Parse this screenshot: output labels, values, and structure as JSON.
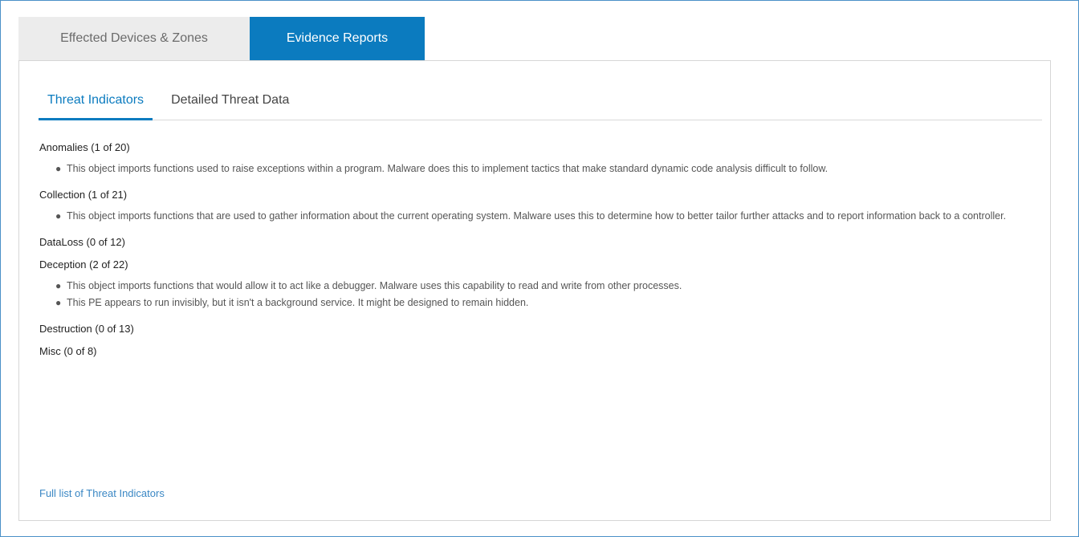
{
  "tabs": {
    "outer": [
      {
        "label": "Effected Devices & Zones",
        "active": false
      },
      {
        "label": "Evidence Reports",
        "active": true
      }
    ],
    "inner": [
      {
        "label": "Threat Indicators",
        "active": true
      },
      {
        "label": "Detailed Threat Data",
        "active": false
      }
    ]
  },
  "categories": [
    {
      "title": "Anomalies (1 of 20)",
      "items": [
        "This object imports functions used to raise exceptions within a program. Malware does this to implement tactics that make standard dynamic code analysis difficult to follow."
      ]
    },
    {
      "title": "Collection (1 of 21)",
      "items": [
        "This object imports functions that are used to gather information about the current operating system. Malware uses this to determine how to better tailor further attacks and to report information back to a controller."
      ]
    },
    {
      "title": "DataLoss (0 of 12)",
      "items": []
    },
    {
      "title": "Deception (2 of 22)",
      "items": [
        "This object imports functions that would allow it to act like a debugger. Malware uses this capability to read and write from other processes.",
        "This PE appears to run invisibly, but it isn't a background service. It might be designed to remain hidden."
      ]
    },
    {
      "title": "Destruction (0 of 13)",
      "items": []
    },
    {
      "title": "Misc (0 of 8)",
      "items": []
    }
  ],
  "full_list_link": "Full list of Threat Indicators",
  "colors": {
    "accent": "#0b7bbf",
    "link": "#3a87c4",
    "inactive_tab_bg": "#ececec"
  }
}
